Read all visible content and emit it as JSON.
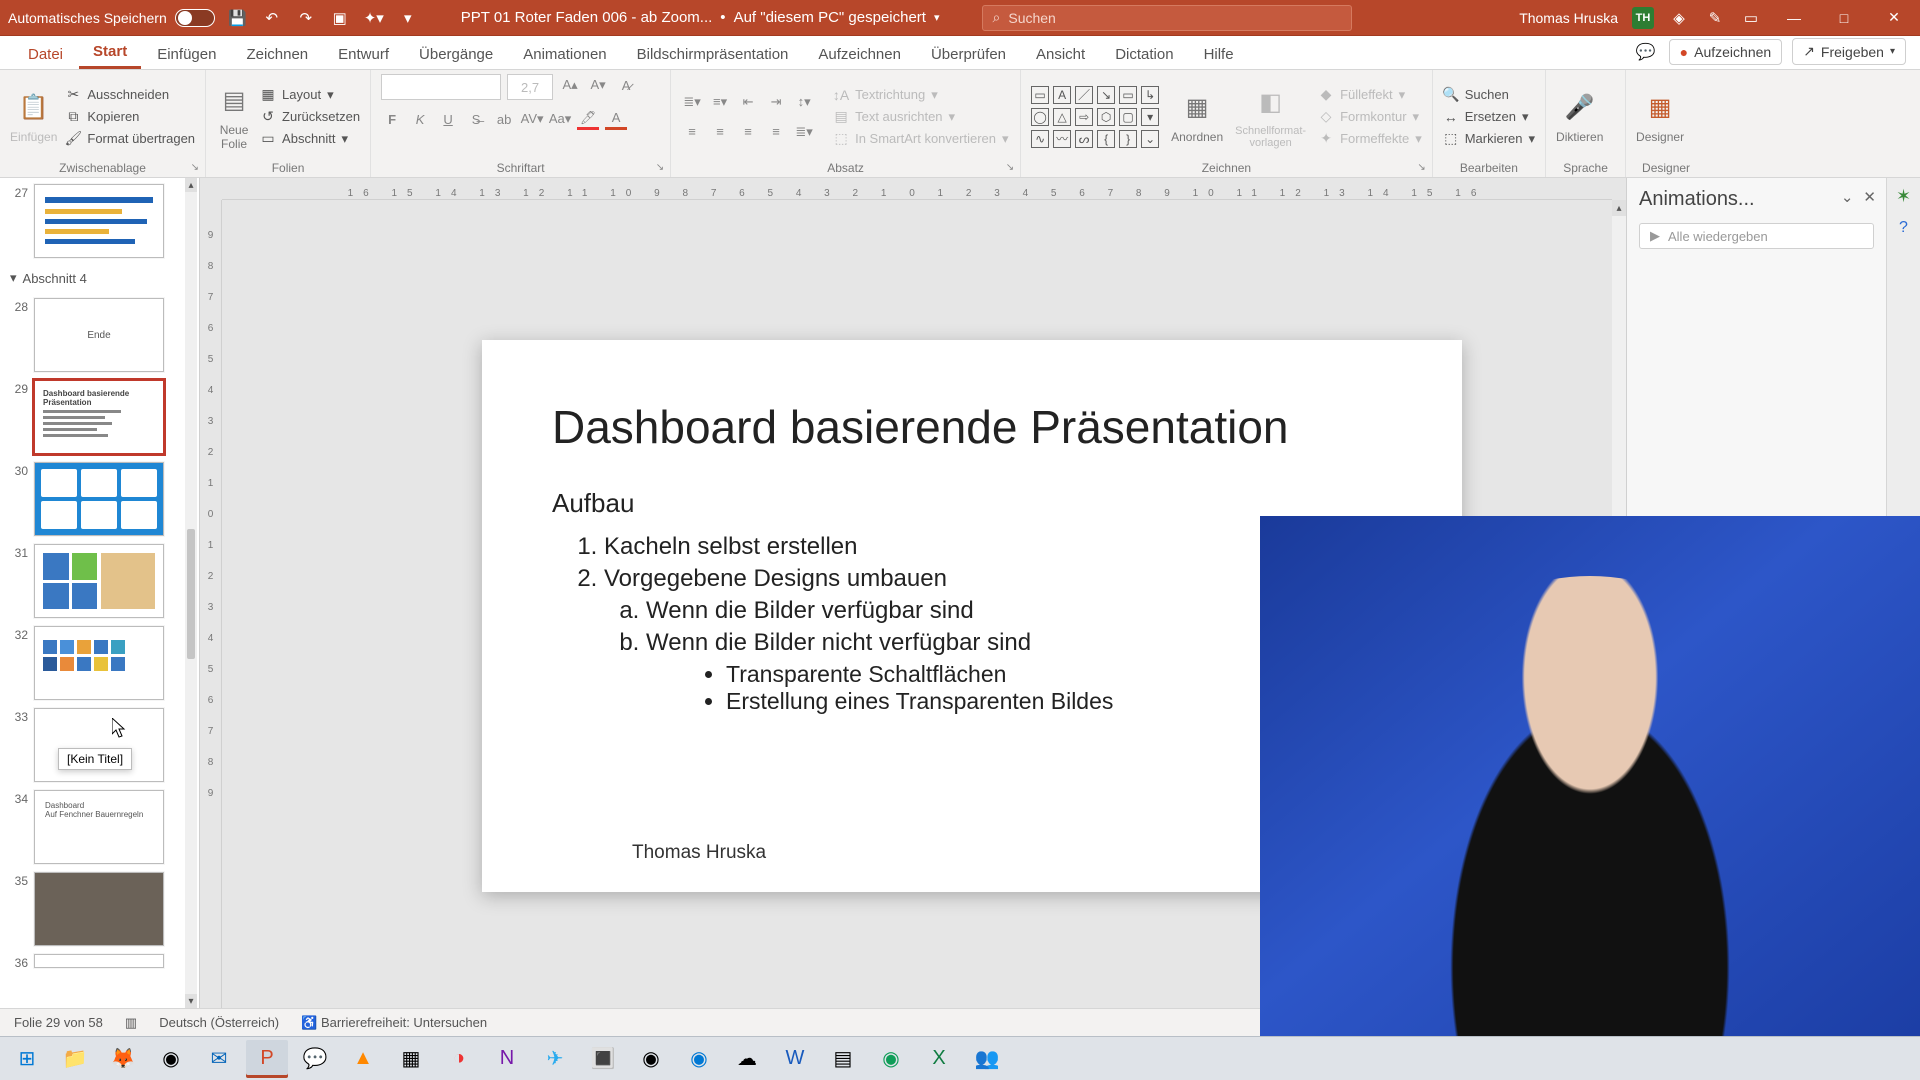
{
  "title_bar": {
    "autosave_label": "Automatisches Speichern",
    "doc_name": "PPT 01 Roter Faden 006 - ab Zoom...",
    "save_state_sep": "•",
    "save_state": "Auf \"diesem PC\" gespeichert",
    "search_placeholder": "Suchen",
    "user_name": "Thomas Hruska",
    "user_initials": "TH"
  },
  "tabs": {
    "file": "Datei",
    "start": "Start",
    "einfuegen": "Einfügen",
    "zeichnen": "Zeichnen",
    "entwurf": "Entwurf",
    "uebergaenge": "Übergänge",
    "animationen": "Animationen",
    "bildschirm": "Bildschirmpräsentation",
    "aufzeichnen": "Aufzeichnen",
    "ueberpruefen": "Überprüfen",
    "ansicht": "Ansicht",
    "dictation": "Dictation",
    "hilfe": "Hilfe",
    "record_btn": "Aufzeichnen",
    "share_btn": "Freigeben"
  },
  "ribbon": {
    "paste": "Einfügen",
    "cut": "Ausschneiden",
    "copy": "Kopieren",
    "format_painter": "Format übertragen",
    "clipboard_label": "Zwischenablage",
    "new_slide": "Neue\nFolie",
    "layout": "Layout",
    "reset": "Zurücksetzen",
    "section": "Abschnitt",
    "slides_label": "Folien",
    "font_name": "",
    "font_size": "2,7",
    "font_label": "Schriftart",
    "paragraph_label": "Absatz",
    "text_direction": "Textrichtung",
    "align_text": "Text ausrichten",
    "smartart": "In SmartArt konvertieren",
    "arrange": "Anordnen",
    "quickstyles": "Schnellformat-\nvorlagen",
    "fill": "Fülleffekt",
    "outline": "Formkontur",
    "effects": "Formeffekte",
    "drawing_label": "Zeichnen",
    "find": "Suchen",
    "replace": "Ersetzen",
    "select": "Markieren",
    "editing_label": "Bearbeiten",
    "dictate": "Diktieren",
    "voice_label": "Sprache",
    "designer": "Designer",
    "designer_label": "Designer"
  },
  "thumbs": {
    "section4": "Abschnitt 4",
    "t27": "27",
    "t28": "28",
    "t28_text": "Ende",
    "t29": "29",
    "t30": "30",
    "t31": "31",
    "t32": "32",
    "t33": "33",
    "t34": "34",
    "t35": "35",
    "t36": "36",
    "tooltip": "[Kein Titel]"
  },
  "slide": {
    "title": "Dashboard basierende Präsentation",
    "sub": "Aufbau",
    "ol1": "Kacheln selbst erstellen",
    "ol2": "Vorgegebene Designs umbauen",
    "ol2a": "Wenn  die Bilder verfügbar sind",
    "ol2b": "Wenn die Bilder nicht verfügbar sind",
    "ul1": "Transparente Schaltflächen",
    "ul2": "Erstellung eines Transparenten Bildes",
    "footer": "Thomas Hruska"
  },
  "side_pane": {
    "title": "Animations...",
    "play_all": "Alle wiedergeben"
  },
  "status": {
    "slide_counter": "Folie 29 von 58",
    "language": "Deutsch (Österreich)",
    "accessibility": "Barrierefreiheit: Untersuchen"
  },
  "ruler": {
    "h": "16  15  14  13  12  11  10  9  8  7  6  5  4  3  2  1  0  1  2  3  4  5  6  7  8  9  10  11  12  13  14  15  16"
  }
}
